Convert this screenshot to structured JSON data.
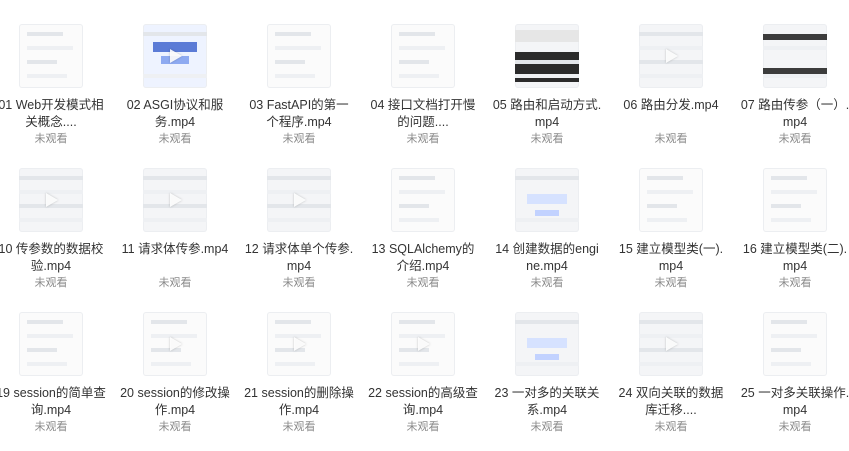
{
  "items": [
    {
      "title": "01 Web开发模式相关概念....",
      "status": "未观看"
    },
    {
      "title": "02 ASGI协议和服务.mp4",
      "status": "未观看"
    },
    {
      "title": "03 FastAPI的第一个程序.mp4",
      "status": "未观看"
    },
    {
      "title": "04 接口文档打开慢的问题....",
      "status": "未观看"
    },
    {
      "title": "05 路由和启动方式.mp4",
      "status": "未观看"
    },
    {
      "title": "06 路由分发.mp4",
      "status": "未观看"
    },
    {
      "title": "07 路由传参（一）.mp4",
      "status": "未观看"
    },
    {
      "title": "10 传参数的数据校验.mp4",
      "status": "未观看"
    },
    {
      "title": "11 请求体传参.mp4",
      "status": "未观看"
    },
    {
      "title": "12 请求体单个传参.mp4",
      "status": "未观看"
    },
    {
      "title": "13 SQLAlchemy的介绍.mp4",
      "status": "未观看"
    },
    {
      "title": "14 创建数据的engine.mp4",
      "status": "未观看"
    },
    {
      "title": "15 建立模型类(一).mp4",
      "status": "未观看"
    },
    {
      "title": "16 建立模型类(二).mp4",
      "status": "未观看"
    },
    {
      "title": "19 session的简单查询.mp4",
      "status": "未观看"
    },
    {
      "title": "20 session的修改操作.mp4",
      "status": "未观看"
    },
    {
      "title": "21 session的删除操作.mp4",
      "status": "未观看"
    },
    {
      "title": "22 session的高级查询.mp4",
      "status": "未观看"
    },
    {
      "title": "23 一对多的关联关系.mp4",
      "status": "未观看"
    },
    {
      "title": "24 双向关联的数据库迁移....",
      "status": "未观看"
    },
    {
      "title": "25 一对多关联操作.mp4",
      "status": "未观看"
    }
  ]
}
